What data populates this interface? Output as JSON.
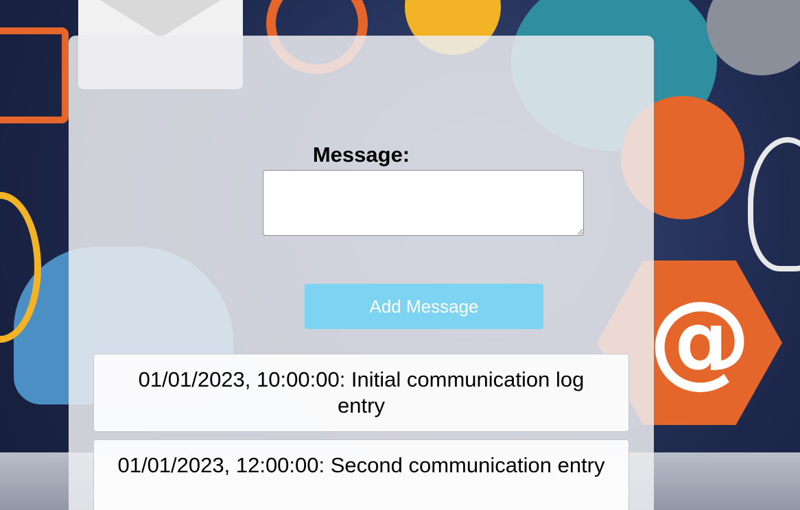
{
  "form": {
    "message_label": "Message:",
    "message_value": "",
    "add_button_label": "Add Message"
  },
  "log": {
    "entries": [
      {
        "text": "01/01/2023, 10:00:00: Initial communication log entry"
      },
      {
        "text": "01/01/2023, 12:00:00: Second communication entry"
      }
    ]
  },
  "background": {
    "decorative_icons": [
      "envelope-icon",
      "percent-badge-icon",
      "coin-icon",
      "globe-icon",
      "book-icon",
      "cloud-icon",
      "mail-icon",
      "at-sign-icon",
      "lightbulb-icon",
      "laptop-icon"
    ],
    "at_sign_glyph": "@"
  },
  "colors": {
    "button_bg": "#7dd3f2",
    "button_text": "#ffffff",
    "panel_bg": "rgba(236,236,240,0.86)",
    "accent_orange": "#e5662b"
  }
}
